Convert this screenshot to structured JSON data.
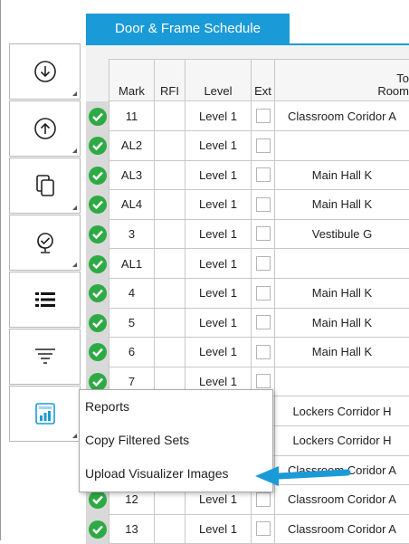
{
  "tab": {
    "title": "Door & Frame Schedule"
  },
  "toolbar": {
    "buttons": [
      {
        "icon": "download-circle-icon",
        "name": "download-button"
      },
      {
        "icon": "upload-circle-icon",
        "name": "upload-button"
      },
      {
        "icon": "copy-icon",
        "name": "copy-button"
      },
      {
        "icon": "globe-check-icon",
        "name": "globe-check-button"
      },
      {
        "icon": "list-icon",
        "name": "list-button"
      },
      {
        "icon": "filter-icon",
        "name": "filter-button"
      },
      {
        "icon": "report-chart-icon",
        "name": "reports-button"
      }
    ]
  },
  "table": {
    "headers": {
      "mark": "Mark",
      "rfi": "RFI",
      "level": "Level",
      "ext": "Ext",
      "to_room_1": "To",
      "to_room_2": "Room"
    },
    "rows": [
      {
        "mark": "11",
        "level": "Level 1",
        "room": "Classroom Coridor A"
      },
      {
        "mark": "AL2",
        "level": "Level 1",
        "room": ""
      },
      {
        "mark": "AL3",
        "level": "Level 1",
        "room": "Main Hall K"
      },
      {
        "mark": "AL4",
        "level": "Level 1",
        "room": "Main Hall K"
      },
      {
        "mark": "3",
        "level": "Level 1",
        "room": "Vestibule G"
      },
      {
        "mark": "AL1",
        "level": "Level 1",
        "room": ""
      },
      {
        "mark": "4",
        "level": "Level 1",
        "room": "Main Hall K"
      },
      {
        "mark": "5",
        "level": "Level 1",
        "room": "Main Hall K"
      },
      {
        "mark": "6",
        "level": "Level 1",
        "room": "Main Hall K"
      },
      {
        "mark": "7",
        "level": "Level 1",
        "room": ""
      },
      {
        "mark": "",
        "level": "",
        "room": "Lockers Corridor H"
      },
      {
        "mark": "",
        "level": "",
        "room": "Lockers Corridor H"
      },
      {
        "mark": "",
        "level": "",
        "room": "Classroom Coridor A"
      },
      {
        "mark": "12",
        "level": "Level 1",
        "room": "Classroom Coridor A"
      },
      {
        "mark": "13",
        "level": "Level 1",
        "room": "Classroom Coridor A"
      }
    ]
  },
  "menu": {
    "items": [
      "Reports",
      "Copy Filtered Sets",
      "Upload Visualizer Images"
    ]
  },
  "colors": {
    "accent": "#1a9bd7",
    "check": "#2eaa45",
    "arrow": "#1a9bd7"
  }
}
